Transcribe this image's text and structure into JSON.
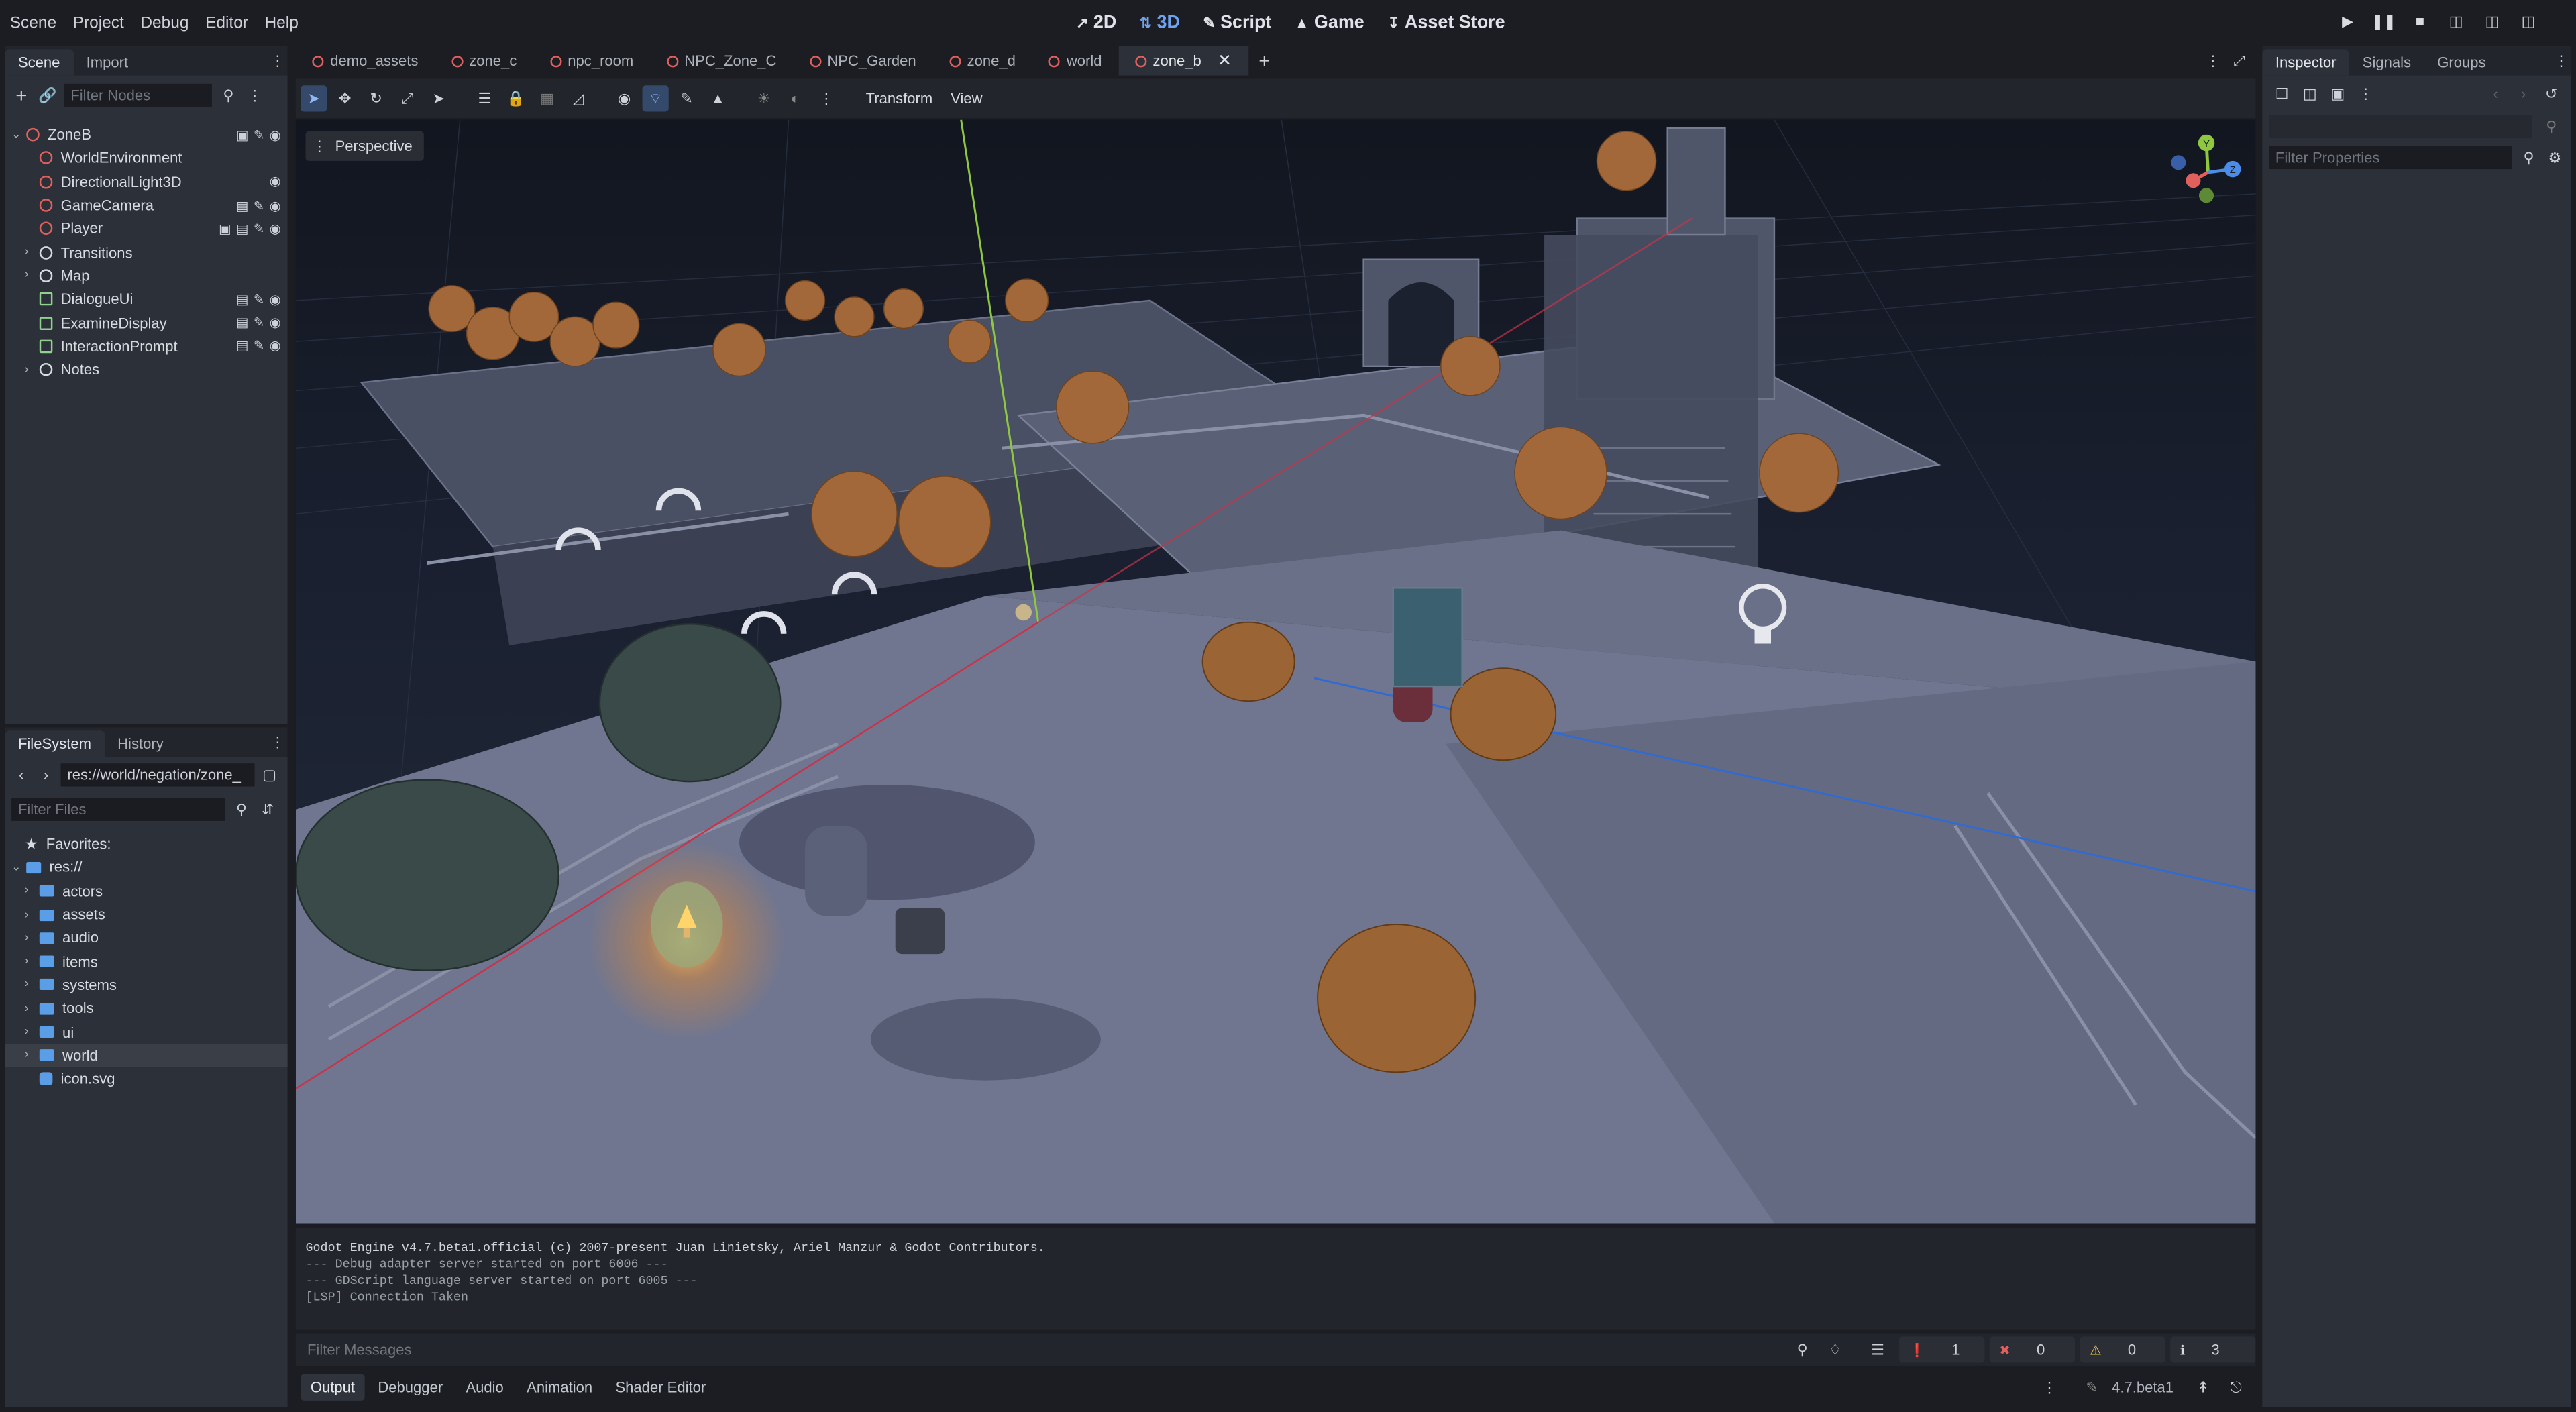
{
  "menu": [
    "Scene",
    "Project",
    "Debug",
    "Editor",
    "Help"
  ],
  "workspaces": [
    {
      "label": "2D",
      "active": false
    },
    {
      "label": "3D",
      "active": true
    },
    {
      "label": "Script",
      "active": false
    },
    {
      "label": "Game",
      "active": false
    },
    {
      "label": "Asset Store",
      "active": false
    }
  ],
  "left_dock": {
    "tabs": [
      "Scene",
      "Import"
    ],
    "filter_placeholder": "Filter Nodes",
    "nodes": [
      {
        "label": "ZoneB",
        "icon": "node3d-root-icon",
        "color": "#e0605d",
        "depth": 0,
        "expand": "open"
      },
      {
        "label": "WorldEnvironment",
        "icon": "world-environment-icon",
        "color": "#e0605d",
        "depth": 1,
        "expand": ""
      },
      {
        "label": "DirectionalLight3D",
        "icon": "directional-light-icon",
        "color": "#e0605d",
        "depth": 1,
        "expand": ""
      },
      {
        "label": "GameCamera",
        "icon": "camera-icon",
        "color": "#e0605d",
        "depth": 1,
        "expand": ""
      },
      {
        "label": "Player",
        "icon": "character-icon",
        "color": "#e0605d",
        "depth": 1,
        "expand": ""
      },
      {
        "label": "Transitions",
        "icon": "node-icon",
        "color": "#d7dbe1",
        "depth": 1,
        "expand": "closed"
      },
      {
        "label": "Map",
        "icon": "node-icon",
        "color": "#d7dbe1",
        "depth": 1,
        "expand": "closed"
      },
      {
        "label": "DialogueUi",
        "icon": "control-icon",
        "color": "#8fd18f",
        "depth": 1,
        "expand": ""
      },
      {
        "label": "ExamineDisplay",
        "icon": "control-icon",
        "color": "#8fd18f",
        "depth": 1,
        "expand": ""
      },
      {
        "label": "InteractionPrompt",
        "icon": "control-icon",
        "color": "#8fd18f",
        "depth": 1,
        "expand": ""
      },
      {
        "label": "Notes",
        "icon": "node-icon",
        "color": "#d7dbe1",
        "depth": 1,
        "expand": "closed"
      }
    ]
  },
  "filesystem": {
    "tabs": [
      "FileSystem",
      "History"
    ],
    "path": "res://world/negation/zone_",
    "filter_placeholder": "Filter Files",
    "favorites_label": "Favorites:",
    "root_label": "res://",
    "folders": [
      "actors",
      "assets",
      "audio",
      "items",
      "systems",
      "tools",
      "ui",
      "world"
    ],
    "files": [
      "icon.svg"
    ],
    "selected": "world"
  },
  "editor_tabs": [
    {
      "label": "demo_assets",
      "active": false
    },
    {
      "label": "zone_c",
      "active": false
    },
    {
      "label": "npc_room",
      "active": false
    },
    {
      "label": "NPC_Zone_C",
      "active": false
    },
    {
      "label": "NPC_Garden",
      "active": false
    },
    {
      "label": "zone_d",
      "active": false
    },
    {
      "label": "world",
      "active": false
    },
    {
      "label": "zone_b",
      "active": true
    }
  ],
  "toolbar": {
    "transform_label": "Transform",
    "view_label": "View"
  },
  "viewport": {
    "perspective_label": "Perspective",
    "gizmo_axes": [
      "Y",
      "Z"
    ]
  },
  "output": {
    "lines": [
      "Godot Engine v4.7.beta1.official (c) 2007-present Juan Linietsky, Ariel Manzur & Godot Contributors.",
      "--- Debug adapter server started on port 6006 ---",
      "--- GDScript language server started on port 6005 ---",
      "[LSP] Connection Taken"
    ],
    "filter_placeholder": "Filter Messages",
    "badges": [
      {
        "kind": "log",
        "count": "1"
      },
      {
        "kind": "error",
        "count": "0"
      },
      {
        "kind": "warning",
        "count": "0"
      },
      {
        "kind": "info",
        "count": "3"
      }
    ]
  },
  "bottom_tabs": [
    "Output",
    "Debugger",
    "Audio",
    "Animation",
    "Shader Editor"
  ],
  "version": "4.7.beta1",
  "inspector": {
    "tabs": [
      "Inspector",
      "Signals",
      "Groups"
    ],
    "filter_placeholder": "Filter Properties"
  },
  "colors": {
    "accent": "#6ea3f0",
    "node3d": "#e0605d",
    "control": "#8fd18f",
    "folder": "#5b9ee8",
    "error": "#e0605d",
    "warning": "#f2c447"
  }
}
